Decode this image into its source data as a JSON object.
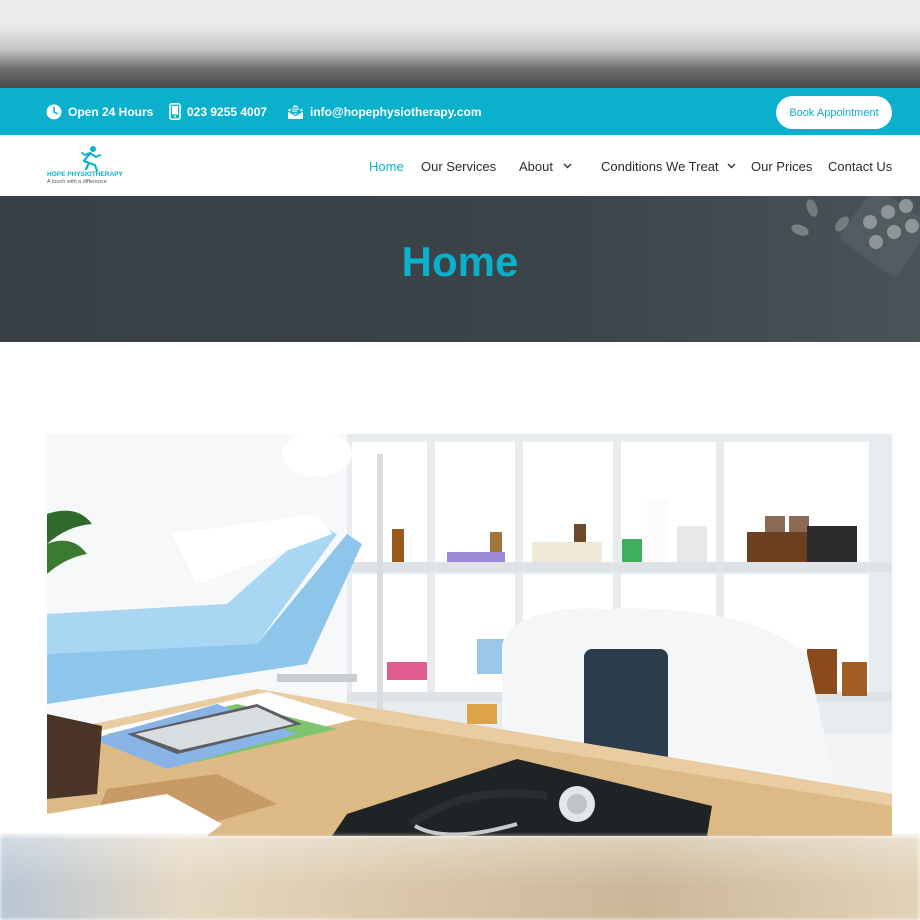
{
  "topbar": {
    "hours": "Open 24 Hours",
    "phone": "023 9255 4007",
    "email": "info@hopephysiotherapy.com",
    "book_label": "Book Appointment"
  },
  "logo": {
    "name": "HOPE PHYSIOTHERAPY",
    "tagline": "A touch with a difference"
  },
  "nav": {
    "items": [
      {
        "label": "Home",
        "active": true
      },
      {
        "label": "Our Services"
      },
      {
        "label": "About",
        "has_dropdown": true
      },
      {
        "label": "Conditions We Treat",
        "has_dropdown": true
      },
      {
        "label": "Our Prices"
      },
      {
        "label": "Contact Us"
      }
    ]
  },
  "hero": {
    "title": "Home"
  },
  "colors": {
    "accent": "#0ab0cc",
    "hero_bg": "#3a4247",
    "text": "#2b2b2b"
  },
  "icons": [
    "clock-icon",
    "phone-icon",
    "mail-icon",
    "runner-logo-icon",
    "chevron-down-icon"
  ]
}
